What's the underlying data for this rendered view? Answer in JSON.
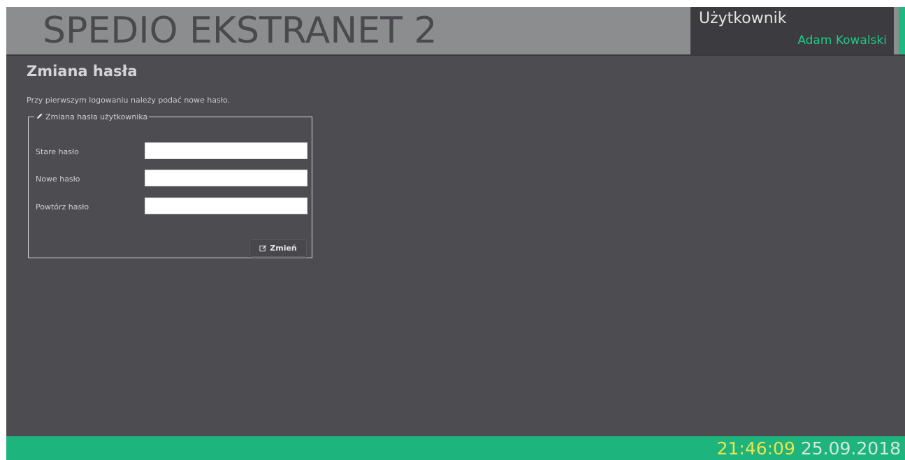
{
  "header": {
    "app_title": "SPEDIO EKSTRANET 2",
    "user_label": "Użytkownik",
    "user_name": "Adam Kowalski"
  },
  "page": {
    "title": "Zmiana hasła",
    "intro": "Przy pierwszym logowaniu należy podać nowe hasło."
  },
  "form": {
    "legend": "Zmiana hasła użytkownika",
    "legend_icon": "pencil-icon",
    "fields": [
      {
        "label": "Stare hasło",
        "value": "",
        "placeholder": ""
      },
      {
        "label": "Nowe hasło",
        "value": "",
        "placeholder": ""
      },
      {
        "label": "Powtórz hasło",
        "value": "",
        "placeholder": ""
      }
    ],
    "submit_label": "Zmień",
    "submit_icon": "edit-icon"
  },
  "footer": {
    "time": "21:46:09",
    "date": "25.09.2018"
  },
  "colors": {
    "header_bg": "#8c8d8f",
    "content_bg": "#4d4c51",
    "user_panel_bg": "#3c3c40",
    "accent_green": "#1db57d",
    "user_name_green": "#1fc88a",
    "clock_time_yellow": "#f0e24a"
  }
}
